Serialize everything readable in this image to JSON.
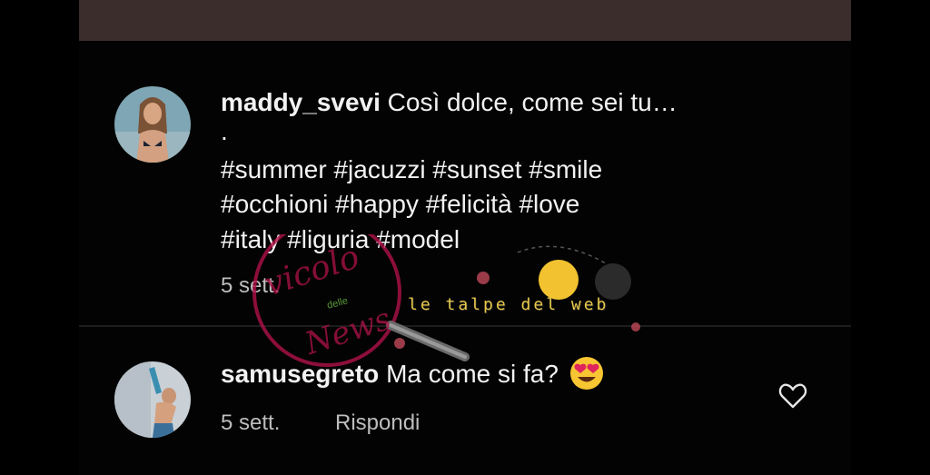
{
  "comments": [
    {
      "username": "maddy_svevi",
      "lines": [
        "Così dolce, come sei tu…",
        ".",
        "#summer #jacuzzi #sunset #smile",
        "#occhioni #happy #felicità #love",
        "#italy #liguria #model"
      ],
      "time": "5 sett."
    },
    {
      "username": "samusegreto",
      "text": "Ma come si fa?",
      "time": "5 sett.",
      "reply_label": "Rispondi",
      "emoji_icon": "heart-eyes-emoji-icon"
    }
  ],
  "watermark": {
    "script_text": "vicolo",
    "small_text": "delle",
    "news_text": "News",
    "banner_text": "le talpe del web"
  },
  "colors": {
    "background": "#030303",
    "top_bar": "#3a2d2b",
    "meta_text": "#bdbdbd",
    "emoji_face": "#f8c632",
    "emoji_heart": "#e0245e"
  }
}
